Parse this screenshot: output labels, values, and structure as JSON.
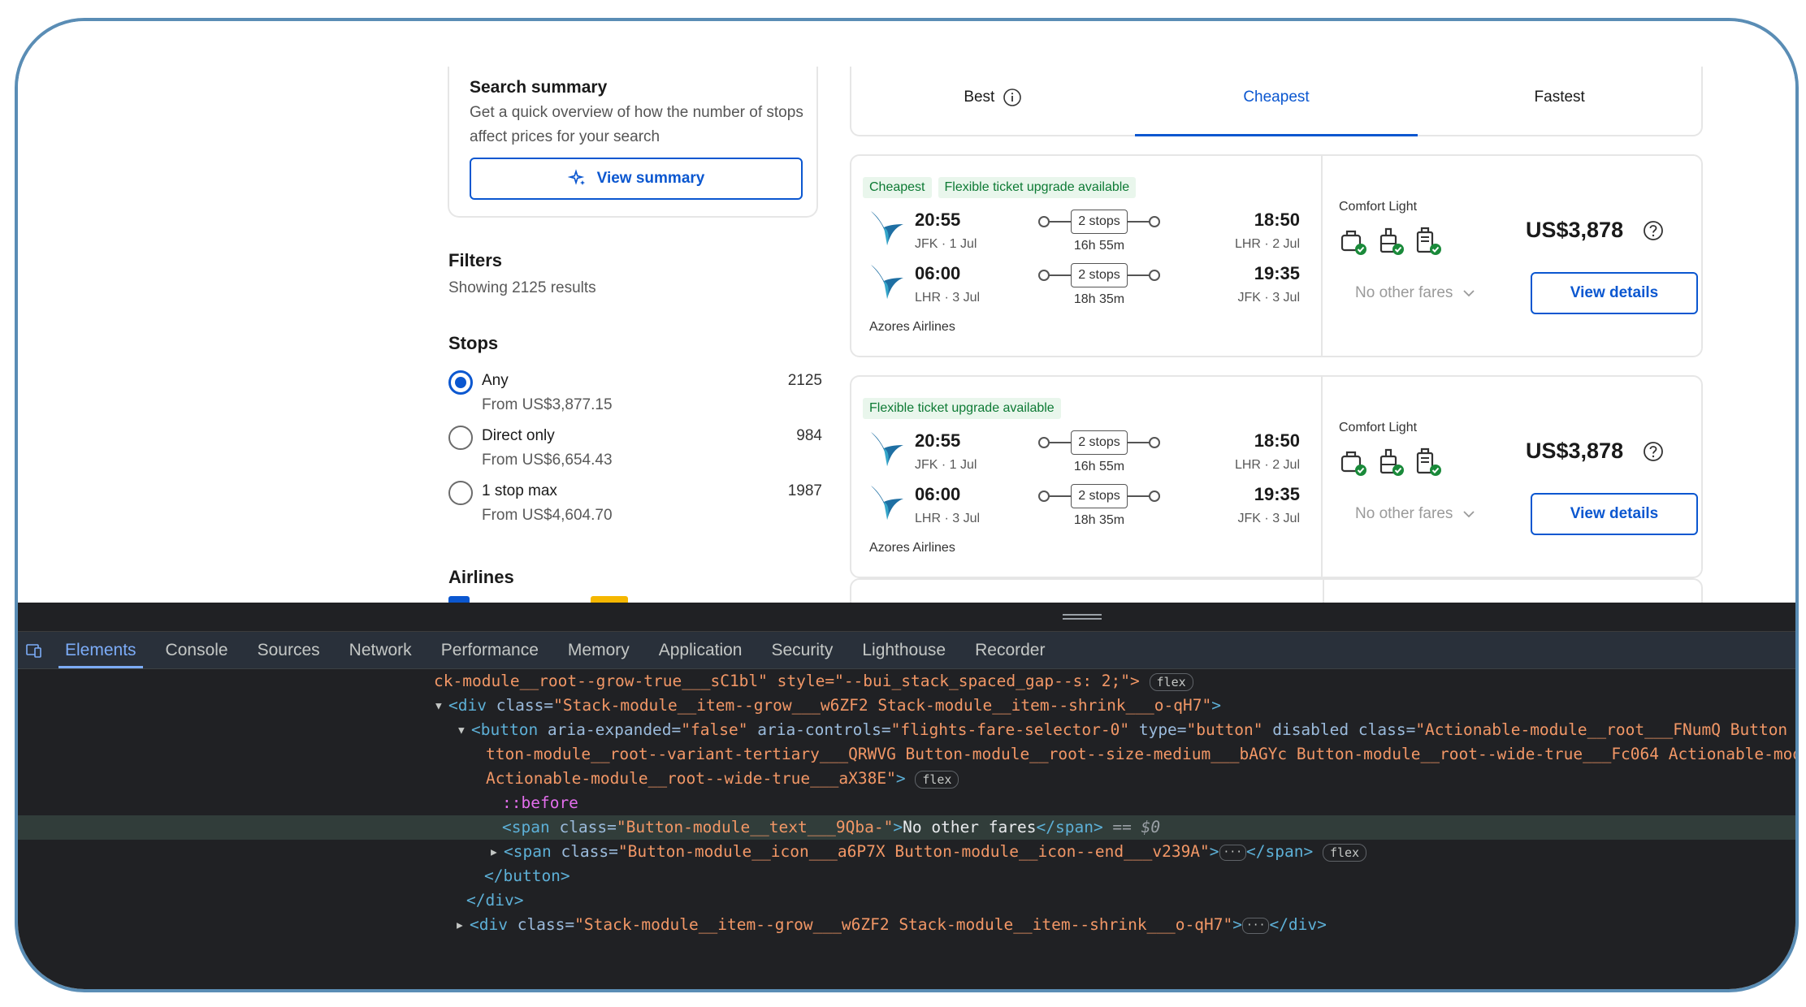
{
  "summary": {
    "title": "Search summary",
    "text": "Get a quick overview of how the number of stops affect prices for your search",
    "button": "View summary"
  },
  "filters": {
    "title": "Filters",
    "count": "Showing 2125 results",
    "stops_title": "Stops",
    "options": [
      {
        "label": "Any",
        "from": "From US$3,877.15",
        "count": "2125",
        "selected": true
      },
      {
        "label": "Direct only",
        "from": "From US$6,654.43",
        "count": "984",
        "selected": false
      },
      {
        "label": "1 stop max",
        "from": "From US$4,604.70",
        "count": "1987",
        "selected": false
      }
    ],
    "airlines_title": "Airlines"
  },
  "tabs": [
    "Best",
    "Cheapest",
    "Fastest"
  ],
  "flights": [
    {
      "badges": [
        "Cheapest",
        "Flexible ticket upgrade available"
      ],
      "legs": [
        {
          "dep_time": "20:55",
          "dep_info": "JFK · 1 Jul",
          "stops": "2 stops",
          "duration": "16h 55m",
          "arr_time": "18:50",
          "arr_info": "LHR · 2 Jul"
        },
        {
          "dep_time": "06:00",
          "dep_info": "LHR · 3 Jul",
          "stops": "2 stops",
          "duration": "18h 35m",
          "arr_time": "19:35",
          "arr_info": "JFK · 3 Jul"
        }
      ],
      "airline": "Azores Airlines",
      "fare_name": "Comfort Light",
      "no_fares": "No other fares",
      "price": "US$3,878",
      "button": "View details"
    },
    {
      "badges": [
        "Flexible ticket upgrade available"
      ],
      "legs": [
        {
          "dep_time": "20:55",
          "dep_info": "JFK · 1 Jul",
          "stops": "2 stops",
          "duration": "16h 55m",
          "arr_time": "18:50",
          "arr_info": "LHR · 2 Jul"
        },
        {
          "dep_time": "06:00",
          "dep_info": "LHR · 3 Jul",
          "stops": "2 stops",
          "duration": "18h 35m",
          "arr_time": "19:35",
          "arr_info": "JFK · 3 Jul"
        }
      ],
      "airline": "Azores Airlines",
      "fare_name": "Comfort Light",
      "no_fares": "No other fares",
      "price": "US$3,878",
      "button": "View details"
    }
  ],
  "devtools": {
    "tabs": [
      "Elements",
      "Console",
      "Sources",
      "Network",
      "Performance",
      "Memory",
      "Application",
      "Security",
      "Lighthouse",
      "Recorder"
    ],
    "active_tab": "Elements",
    "lines": {
      "l0_text": "ck-module__root--grow-true___sC1bl\" style=\"--bui_stack_spaced_gap--s: 2;\">",
      "l0_pill": "flex",
      "l1_tag": "<div ",
      "l1_attr": "class=",
      "l1_val": "\"Stack-module__item--grow___w6ZF2 Stack-module__item--shrink___o-qH7\"",
      "l1_end": ">",
      "l2_tag": "<button ",
      "l2_a1": "aria-expanded=",
      "l2_v1": "\"false\"",
      "l2_a2": " aria-controls=",
      "l2_v2": "\"flights-fare-selector-0\"",
      "l2_a3": " type=",
      "l2_v3": "\"button\"",
      "l2_a4": " disabled class=",
      "l2_v4": "\"Actionable-module__root___FNumQ Button",
      "l3_val": "tton-module__root--variant-tertiary___QRWVG Button-module__root--size-medium___bAGYc Button-module__root--wide-true___Fc064 Actionable-mod",
      "l4_val": "Actionable-module__root--wide-true___aX38E\"",
      "l4_end": ">",
      "l4_pill": "flex",
      "l5_pseudo": "::before",
      "l6_tag": "<span ",
      "l6_attr": "class=",
      "l6_val": "\"Button-module__text___9Qba-\"",
      "l6_open_end": ">",
      "l6_text": "No other fares",
      "l6_close": "</span>",
      "l6_ref": " == $0",
      "l7_tag": "<span ",
      "l7_attr": "class=",
      "l7_val": "\"Button-module__icon___a6P7X Button-module__icon--end___v239A\"",
      "l7_end": ">",
      "l7_ell": "···",
      "l7_close": "</span>",
      "l7_pill": "flex",
      "l8": "</button>",
      "l9": "</div>",
      "l10_tag": "<div ",
      "l10_attr": "class=",
      "l10_val": "\"Stack-module__item--grow___w6ZF2 Stack-module__item--shrink___o-qH7\"",
      "l10_end": ">",
      "l10_ell": "···",
      "l10_close": "</div>"
    }
  },
  "colors": {
    "accent": "#0b57d0",
    "green_badge": "#0d7a34",
    "devtools_bg": "#202124",
    "frame_border": "#5a8db5"
  }
}
